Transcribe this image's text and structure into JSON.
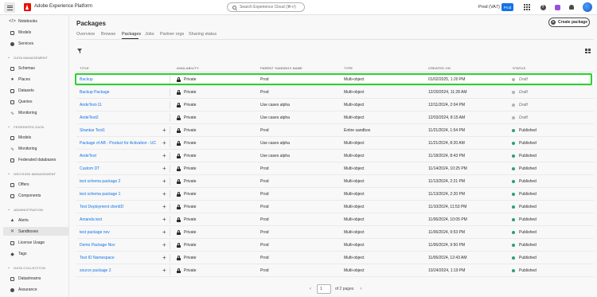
{
  "app": {
    "brand": "Adobe Experience Platform",
    "search_placeholder": "Search Experience Cloud (⌘+/)",
    "org_label": "Prod (VA7)",
    "sandbox_badge": "Prod"
  },
  "sidebar": {
    "items_top": [
      {
        "label": "Notebooks",
        "icon": "code-icon"
      },
      {
        "label": "Models",
        "icon": "models-icon"
      },
      {
        "label": "Services",
        "icon": "services-icon"
      }
    ],
    "sections": [
      {
        "heading": "DATA MANAGEMENT",
        "items": [
          "Schemas",
          "Places",
          "Datasets",
          "Queries",
          "Monitoring"
        ]
      },
      {
        "heading": "FEDERATED DATA",
        "items": [
          "Models",
          "Monitoring",
          "Federated databases"
        ]
      },
      {
        "heading": "DECISION MANAGEMENT",
        "items": [
          "Offers",
          "Components"
        ]
      },
      {
        "heading": "ADMINISTRATION",
        "items": [
          "Alerts",
          "Sandboxes",
          "License Usage",
          "Tags"
        ]
      },
      {
        "heading": "DATA COLLECTION",
        "items": [
          "Datastreams",
          "Assurance"
        ]
      }
    ],
    "active": "Sandboxes"
  },
  "page": {
    "title": "Packages",
    "create_label": "Create package",
    "tabs": [
      "Overview",
      "Browse",
      "Packages",
      "Jobs",
      "Partner orgs",
      "Sharing status"
    ],
    "active_tab": "Packages"
  },
  "table": {
    "headers": [
      "TITLE",
      "AVAILABILITY",
      "PARENT SANDBOX NAME",
      "TYPE",
      "CREATED ON",
      "STATUS"
    ],
    "rows": [
      {
        "title": "Backup",
        "availability": "Private",
        "parent": "Prod",
        "type": "Multi-object",
        "created": "01/02/2025, 1:20 PM",
        "status": "Draft",
        "add": false
      },
      {
        "title": "Backup Package",
        "availability": "Private",
        "parent": "Prod",
        "type": "Multi-object",
        "created": "12/20/2024, 11:28 AM",
        "status": "Draft",
        "add": false
      },
      {
        "title": "AndeTest-11",
        "availability": "Private",
        "parent": "Use cases alpha",
        "type": "Multi-object",
        "created": "12/11/2024, 2:04 PM",
        "status": "Draft",
        "add": false
      },
      {
        "title": "AndeTest2",
        "availability": "Private",
        "parent": "Use cases alpha",
        "type": "Multi-object",
        "created": "12/03/2024, 8:15 AM",
        "status": "Draft",
        "add": false
      },
      {
        "title": "Shankar Test1",
        "availability": "Private",
        "parent": "Prod",
        "type": "Entire sandbox",
        "created": "11/21/2024, 1:54 PM",
        "status": "Published",
        "add": true
      },
      {
        "title": "Package of AB - Product for Activation - UC",
        "availability": "Private",
        "parent": "Use cases alpha",
        "type": "Multi-object",
        "created": "11/21/2024, 8:20 AM",
        "status": "Published",
        "add": true
      },
      {
        "title": "AndeTest",
        "availability": "Private",
        "parent": "Use cases alpha",
        "type": "Multi-object",
        "created": "11/18/2024, 8:43 PM",
        "status": "Published",
        "add": true
      },
      {
        "title": "Custom DT",
        "availability": "Private",
        "parent": "Prod",
        "type": "Multi-object",
        "created": "11/14/2024, 10:25 PM",
        "status": "Published",
        "add": true
      },
      {
        "title": "test schema package 2",
        "availability": "Private",
        "parent": "Prod",
        "type": "Multi-object",
        "created": "11/13/2024, 2:21 PM",
        "status": "Published",
        "add": true
      },
      {
        "title": "test schema package 1",
        "availability": "Private",
        "parent": "Prod",
        "type": "Multi-object",
        "created": "11/13/2024, 2:20 PM",
        "status": "Published",
        "add": true
      },
      {
        "title": "Test Deployment clientID",
        "availability": "Private",
        "parent": "Prod",
        "type": "Multi-object",
        "created": "11/10/2024, 11:53 PM",
        "status": "Published",
        "add": true
      },
      {
        "title": "Amanda test",
        "availability": "Private",
        "parent": "Prod",
        "type": "Multi-object",
        "created": "11/06/2024, 10:05 PM",
        "status": "Published",
        "add": true
      },
      {
        "title": "test package nov",
        "availability": "Private",
        "parent": "Prod",
        "type": "Multi-object",
        "created": "11/06/2024, 9:53 PM",
        "status": "Published",
        "add": true
      },
      {
        "title": "Demo Package Nov",
        "availability": "Private",
        "parent": "Prod",
        "type": "Multi-object",
        "created": "11/06/2024, 9:50 PM",
        "status": "Published",
        "add": true
      },
      {
        "title": "Test ID Namespace",
        "availability": "Private",
        "parent": "Prod",
        "type": "Multi-object",
        "created": "11/06/2024, 12:43 AM",
        "status": "Published",
        "add": true
      },
      {
        "title": "source package 2",
        "availability": "Private",
        "parent": "Prod",
        "type": "Multi-object",
        "created": "10/24/2024, 1:19 PM",
        "status": "Published",
        "add": true
      }
    ]
  },
  "pagination": {
    "current": "1",
    "of_text": "of 2 pages"
  },
  "colors": {
    "draft": "#b3b3b3",
    "published": "#2d9d78",
    "link": "#1473e6",
    "highlight": "#2ed02e"
  }
}
